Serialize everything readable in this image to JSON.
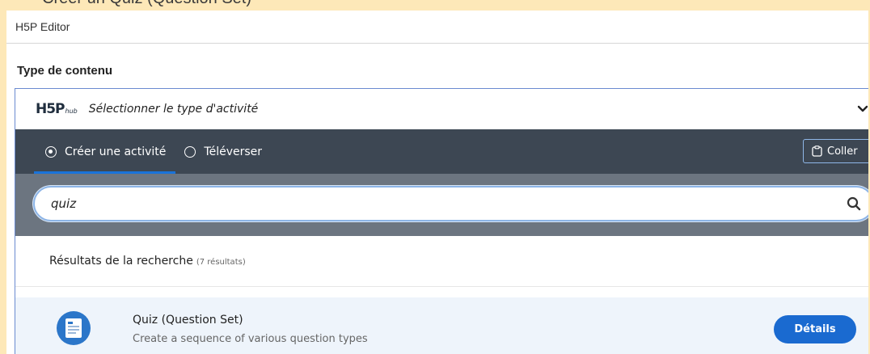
{
  "page": {
    "top_title": "Créer un Quiz (Question Set)"
  },
  "editor": {
    "title": "H5P Editor"
  },
  "content_type": {
    "label": "Type de contenu"
  },
  "hub": {
    "logo_main": "H5P",
    "logo_sub": "hub",
    "select_text": "Sélectionner le type d'activité"
  },
  "tabs": {
    "create_label": "Créer une activité",
    "upload_label": "Téléverser",
    "paste_label": "Coller"
  },
  "search": {
    "value": "quiz",
    "icon": "search-icon"
  },
  "results": {
    "header": "Résultats de la recherche",
    "count": "(7 résultats)",
    "items": [
      {
        "title": "Quiz (Question Set)",
        "description": "Create a sequence of various question types",
        "button": "Détails",
        "icon": "question-set-icon"
      }
    ]
  },
  "colors": {
    "accent": "#1a6ad0",
    "tabs_bg": "#3d4753",
    "search_bg": "#6c7580",
    "page_bg": "#fde8b8"
  }
}
